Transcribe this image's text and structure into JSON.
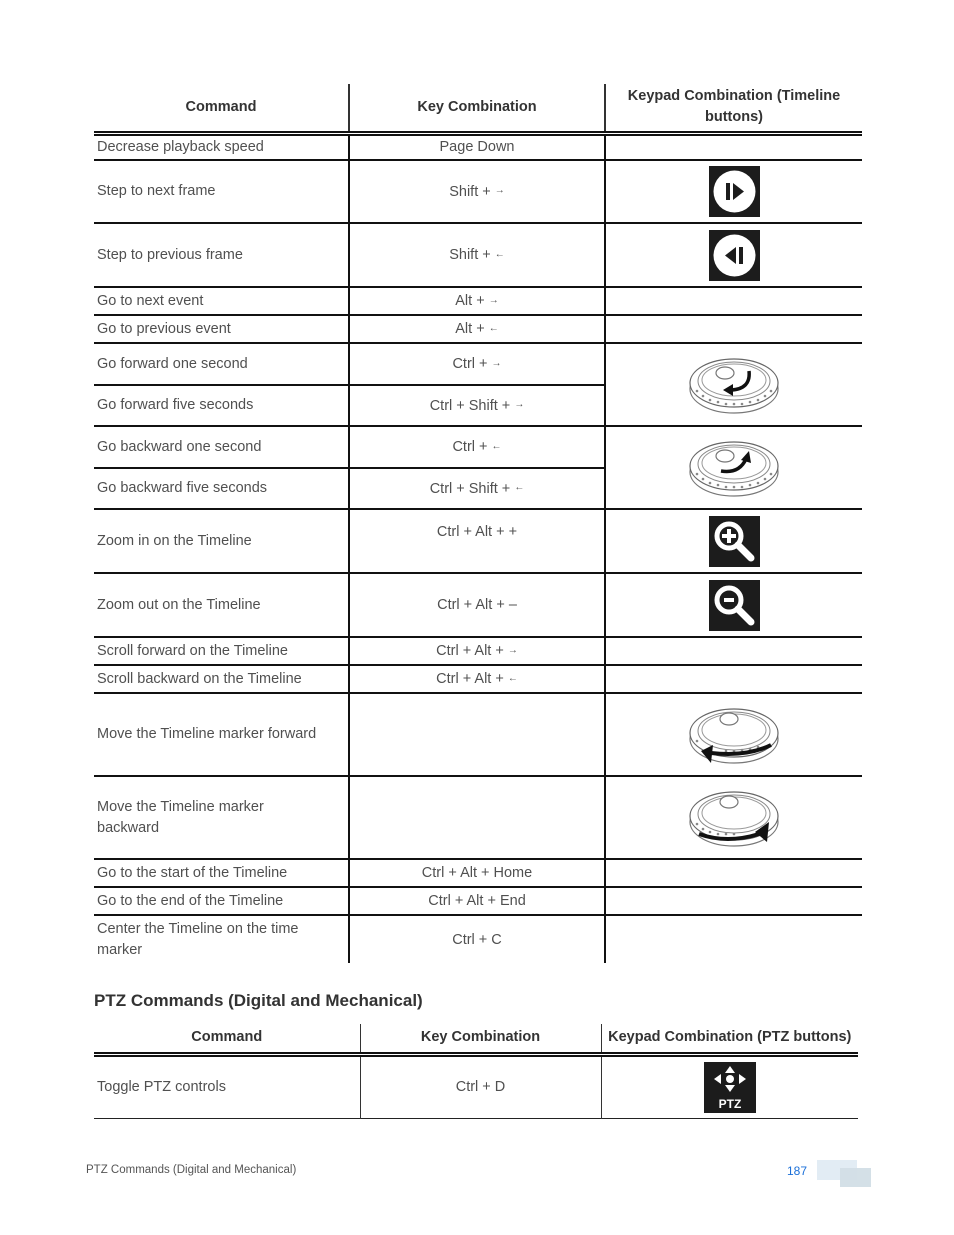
{
  "timeline_table": {
    "headers": {
      "command": "Command",
      "key": "Key Combination",
      "keypad": "Keypad Combination (Timeline buttons)"
    },
    "rows": [
      {
        "command": "Decrease playback speed",
        "key": "Page Down",
        "keypad_icon": ""
      },
      {
        "command": "Step to next frame",
        "key": "Shift + ",
        "key_arrow": "→",
        "keypad_icon": "step-forward-button-icon"
      },
      {
        "command": "Step to previous frame",
        "key": "Shift + ",
        "key_arrow": "←",
        "keypad_icon": "step-back-button-icon"
      },
      {
        "command": "Go to next event",
        "key": "Alt + ",
        "key_arrow": "→",
        "keypad_icon": ""
      },
      {
        "command": "Go to previous event",
        "key": "Alt + ",
        "key_arrow": "←",
        "keypad_icon": ""
      },
      {
        "command": "Go forward one second",
        "key": "Ctrl + ",
        "key_arrow": "→",
        "keypad_icon": "jog-dial-counterclockwise-icon"
      },
      {
        "command": "Go forward five seconds",
        "key": "Ctrl + Shift + ",
        "key_arrow": "→",
        "keypad_icon": "jog-dial-counterclockwise-icon"
      },
      {
        "command": "Go backward one second",
        "key": "Ctrl + ",
        "key_arrow": "←",
        "keypad_icon": "jog-dial-clockwise-icon"
      },
      {
        "command": "Go backward five seconds",
        "key": "Ctrl + Shift + ",
        "key_arrow": "←",
        "keypad_icon": "jog-dial-clockwise-icon"
      },
      {
        "command": "Zoom in on the Timeline",
        "key": "Ctrl + Alt + +",
        "keypad_icon": "zoom-in-button-icon"
      },
      {
        "command": "Zoom out on the Timeline",
        "key": "Ctrl + Alt + –",
        "keypad_icon": "zoom-out-button-icon"
      },
      {
        "command": "Scroll forward on the Timeline",
        "key": "Ctrl + Alt + ",
        "key_arrow": "→",
        "keypad_icon": ""
      },
      {
        "command": "Scroll backward on the Timeline",
        "key": "Ctrl + Alt + ",
        "key_arrow": "←",
        "keypad_icon": ""
      },
      {
        "command": "Move the Timeline marker forward",
        "key": "",
        "keypad_icon": "shuttle-ring-counterclockwise-icon"
      },
      {
        "command": "Move the Timeline marker backward",
        "key": "",
        "keypad_icon": "shuttle-ring-clockwise-icon"
      },
      {
        "command": "Go to the start of the Timeline",
        "key": "Ctrl + Alt + Home",
        "keypad_icon": ""
      },
      {
        "command": "Go to the end of the Timeline",
        "key": "Ctrl + Alt + End",
        "keypad_icon": ""
      },
      {
        "command": "Center the Timeline on the time marker",
        "key": "Ctrl + C",
        "keypad_icon": ""
      }
    ]
  },
  "ptz_section": {
    "title": "PTZ Commands (Digital and Mechanical)",
    "headers": {
      "command": "Command",
      "key": "Key Combination",
      "keypad": "Keypad Combination (PTZ buttons)"
    },
    "rows": [
      {
        "command": "Toggle PTZ controls",
        "key": "Ctrl + D",
        "keypad_icon": "ptz-button-icon",
        "keypad_icon_label": "PTZ"
      }
    ]
  },
  "footer": {
    "section": "PTZ  Commands (Digital and Mechanical)",
    "page_number": "187"
  }
}
